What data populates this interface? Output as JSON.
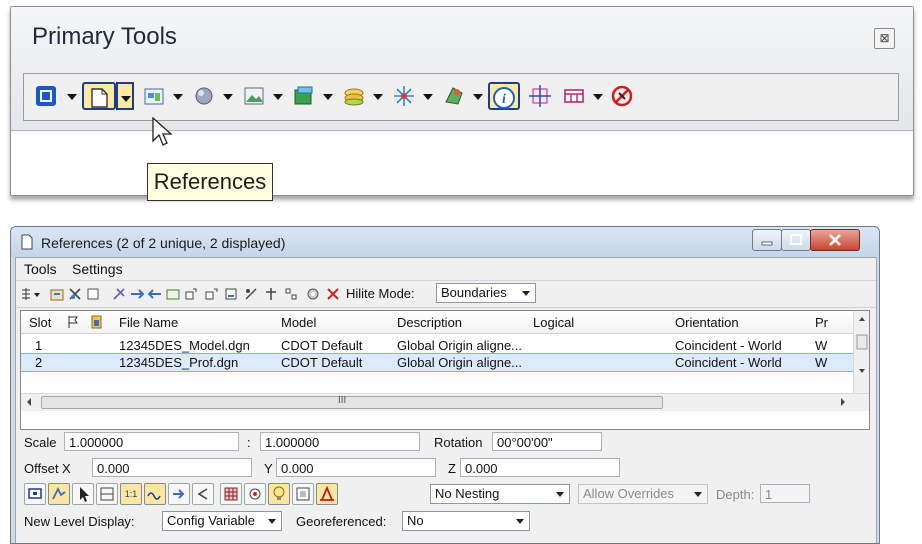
{
  "primary_tools": {
    "title": "Primary Tools",
    "close_glyph": "⊠",
    "tooltip": "References",
    "tools": [
      {
        "icon": "level-manager-icon",
        "dropdown": true
      },
      {
        "icon": "references-icon",
        "dropdown": true,
        "state": "hovered"
      },
      {
        "icon": "raster-manager-icon",
        "dropdown": true
      },
      {
        "icon": "models-icon",
        "dropdown": true
      },
      {
        "icon": "saved-views-icon",
        "dropdown": true
      },
      {
        "icon": "level-display-icon",
        "dropdown": true
      },
      {
        "icon": "display-styles-icon",
        "dropdown": true
      },
      {
        "icon": "accudraw-icon",
        "dropdown": true
      },
      {
        "icon": "render-icon",
        "dropdown": true
      },
      {
        "icon": "element-info-icon",
        "dropdown": false,
        "state": "active"
      },
      {
        "icon": "accusnap-icon",
        "dropdown": false
      },
      {
        "icon": "view-toggles-icon",
        "dropdown": true
      },
      {
        "icon": "no-nesting-icon",
        "dropdown": false
      }
    ]
  },
  "references": {
    "title": "References (2 of 2 unique, 2 displayed)",
    "menu": [
      "Tools",
      "Settings"
    ],
    "toolbar": {
      "hilite_label": "Hilite Mode:",
      "hilite_value": "Boundaries"
    },
    "columns": [
      "Slot",
      "File Name",
      "Model",
      "Description",
      "Logical",
      "Orientation",
      "Pr"
    ],
    "rows": [
      {
        "slot": "1",
        "file": "12345DES_Model.dgn",
        "model": "CDOT Default",
        "description": "Global Origin aligne...",
        "logical": "",
        "orientation": "Coincident - World",
        "pr": "W",
        "selected": false
      },
      {
        "slot": "2",
        "file": "12345DES_Prof.dgn",
        "model": "CDOT Default",
        "description": "Global Origin aligne...",
        "logical": "",
        "orientation": "Coincident - World",
        "pr": "W",
        "selected": true
      }
    ],
    "hscroll_mark": "III",
    "scale": {
      "label": "Scale",
      "value1": "1.000000",
      "sep": ":",
      "value2": "1.000000"
    },
    "rotation": {
      "label": "Rotation",
      "value": "00°00'00\""
    },
    "offset": {
      "label": "Offset X",
      "x": "0.000",
      "y_label": "Y",
      "y": "0.000",
      "z_label": "Z",
      "z": "0.000"
    },
    "nesting": "No Nesting",
    "overrides": "Allow Overrides",
    "depth_label": "Depth:",
    "depth": "1",
    "new_level_label": "New Level Display:",
    "new_level_value": "Config Variable",
    "geo_label": "Georeferenced:",
    "geo_value": "No"
  }
}
